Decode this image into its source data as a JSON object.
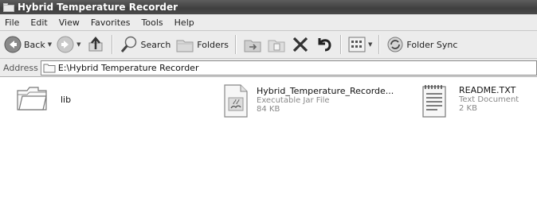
{
  "window": {
    "title": "Hybrid Temperature Recorder"
  },
  "menu": {
    "items": [
      "File",
      "Edit",
      "View",
      "Favorites",
      "Tools",
      "Help"
    ]
  },
  "toolbar": {
    "back_label": "Back",
    "search_label": "Search",
    "folders_label": "Folders",
    "folder_sync_label": "Folder Sync"
  },
  "address": {
    "label": "Address",
    "value": "E:\\Hybrid Temperature Recorder"
  },
  "files": [
    {
      "name": "lib",
      "type": "",
      "size": "",
      "icon": "folder-icon"
    },
    {
      "name": "Hybrid_Temperature_Recorde...",
      "type": "Executable Jar File",
      "size": "84 KB",
      "icon": "jar-file-icon"
    },
    {
      "name": "README.TXT",
      "type": "Text Document",
      "size": "2 KB",
      "icon": "text-document-icon"
    }
  ]
}
